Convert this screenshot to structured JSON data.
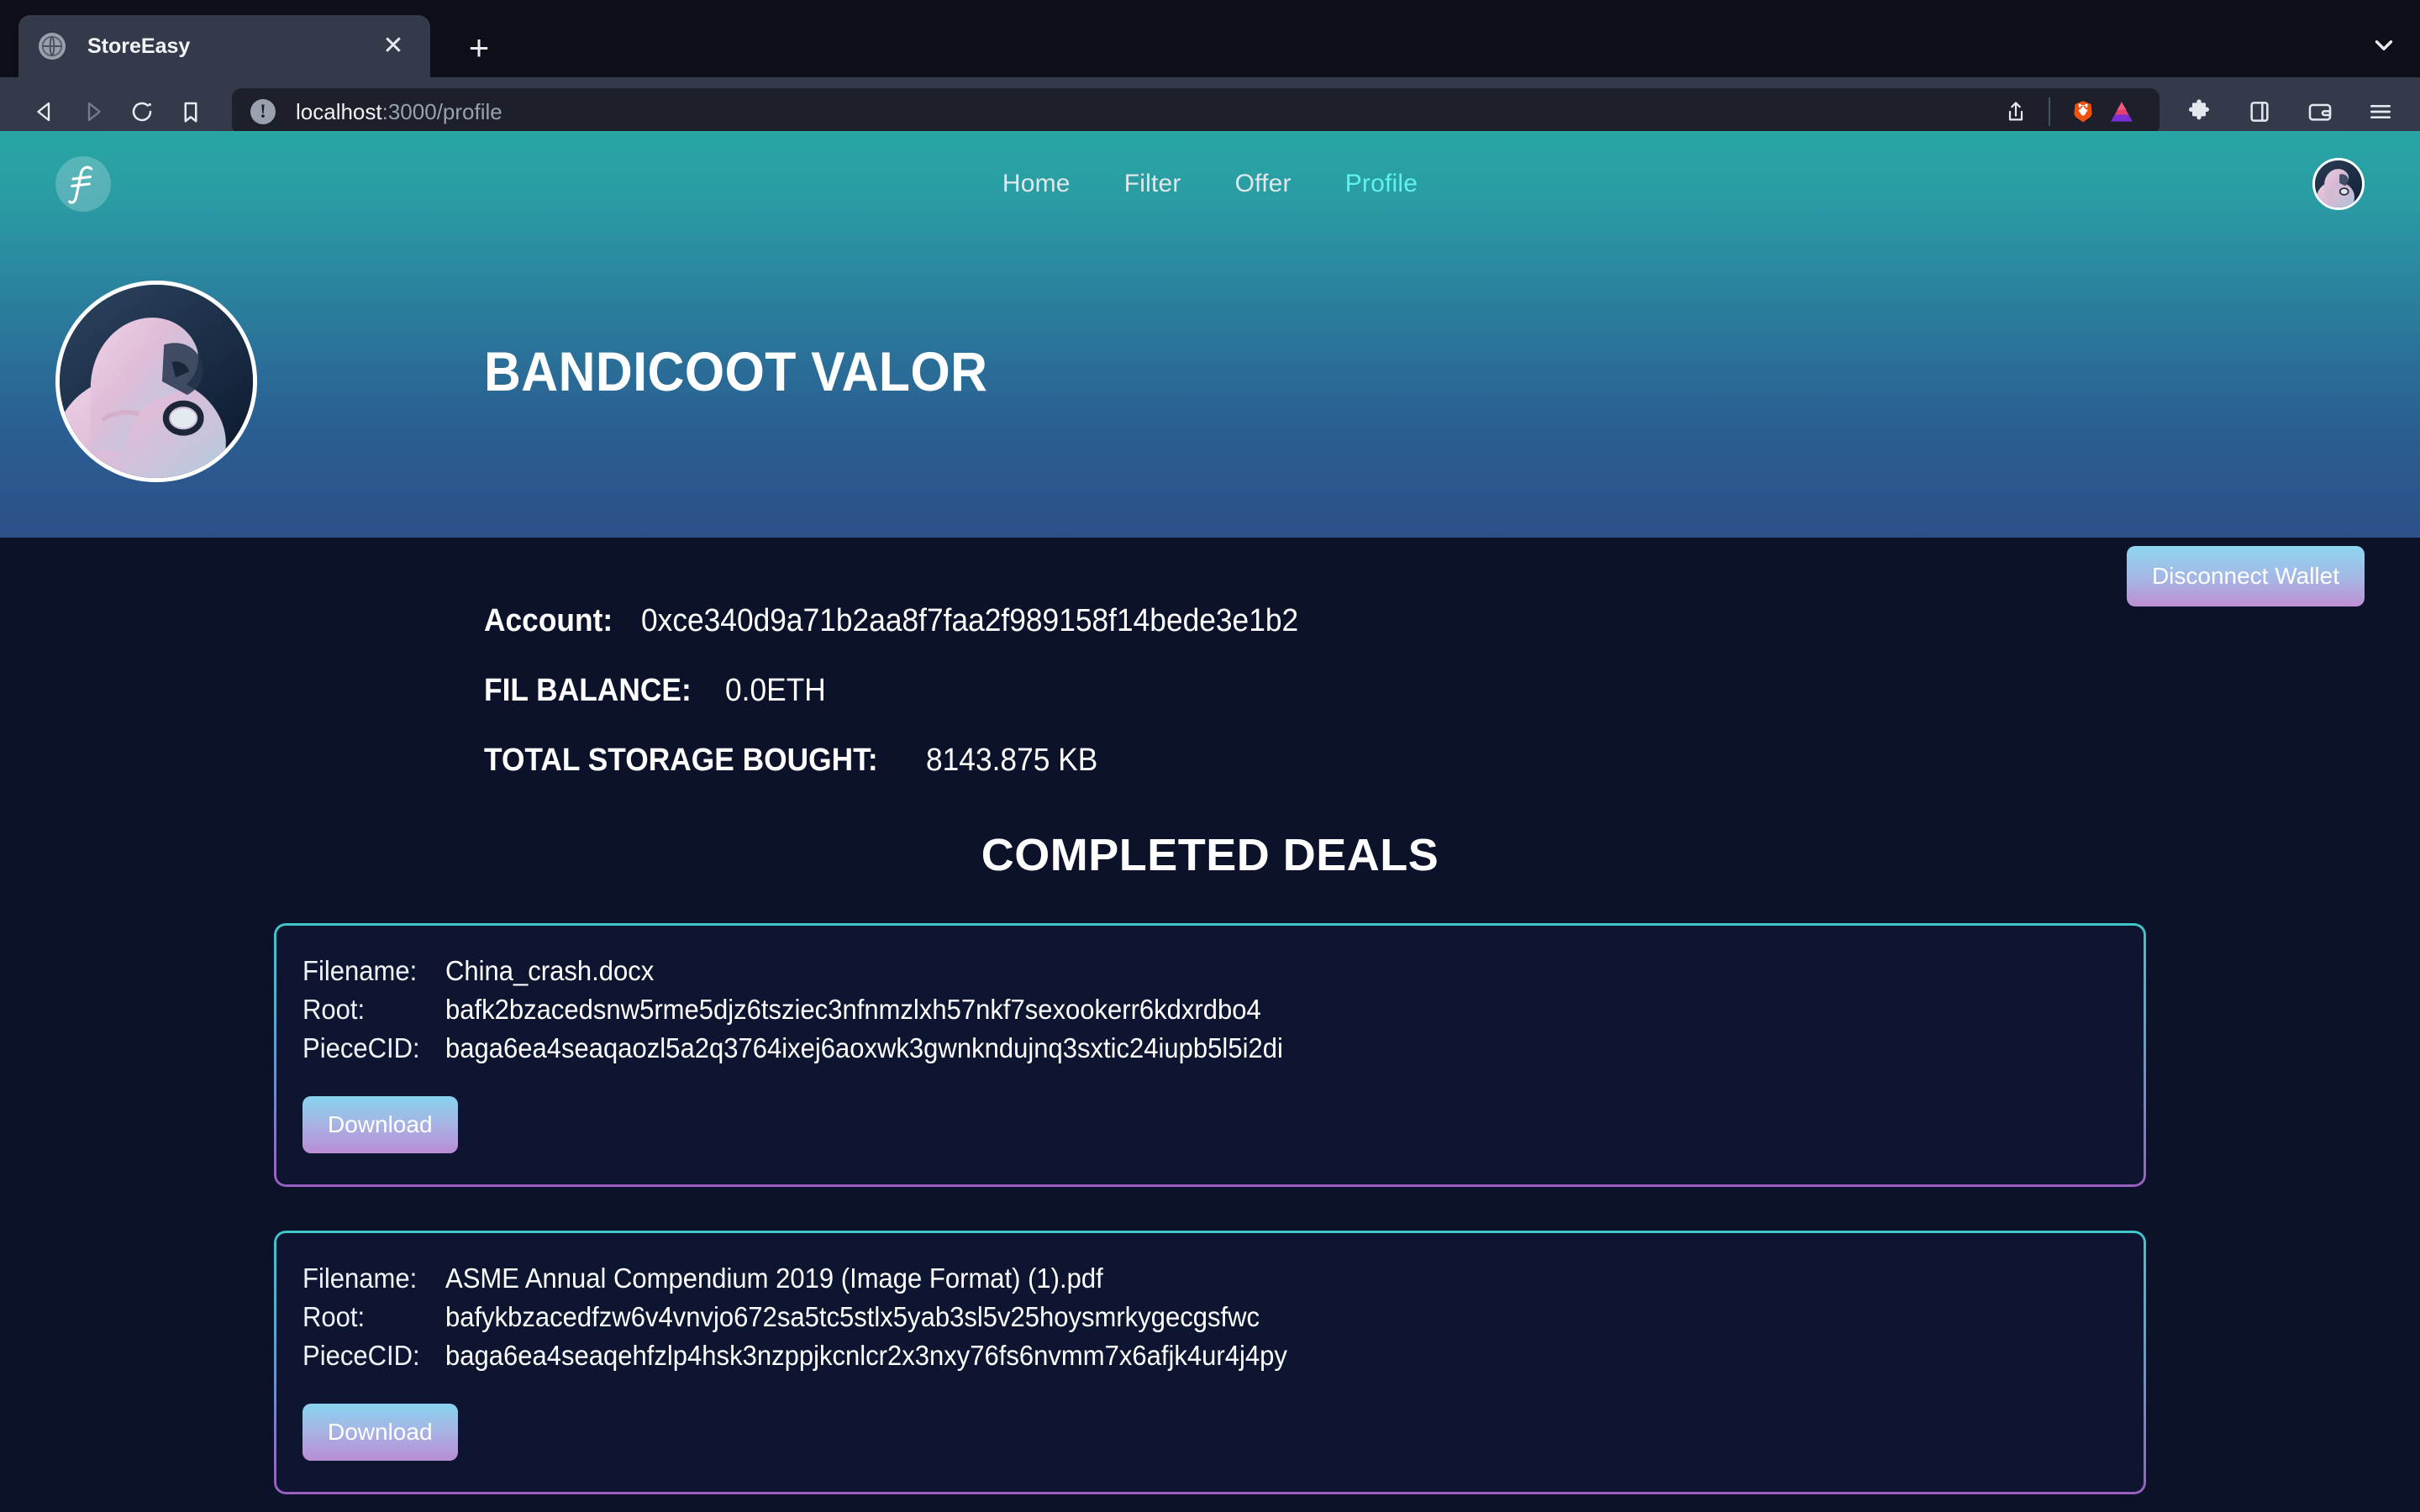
{
  "browser": {
    "tab": {
      "title": "StoreEasy",
      "favicon_icon": "globe-icon",
      "close_icon": "close-icon"
    },
    "new_tab_label": "+",
    "tab_list_chevron": "chevron-down-icon",
    "back_icon": "back-arrow-icon",
    "forward_icon": "forward-arrow-icon",
    "reload_icon": "reload-icon",
    "bookmark_icon": "bookmark-icon",
    "url": {
      "host": "localhost",
      "path": ":3000/profile",
      "full": "localhost:3000/profile",
      "info_icon": "info-icon"
    },
    "url_actions": {
      "share_icon": "share-icon",
      "brave_shields_icon": "brave-lion-icon",
      "bat_rewards_icon": "bat-triangle-icon"
    },
    "toolbar": {
      "extensions_icon": "puzzle-piece-icon",
      "sidebar_icon": "sidebar-panel-icon",
      "wallet_icon": "wallet-icon",
      "menu_icon": "hamburger-menu-icon"
    }
  },
  "site": {
    "logo_icon": "filecoin-logo-icon",
    "nav": [
      {
        "label": "Home",
        "active": false
      },
      {
        "label": "Filter",
        "active": false
      },
      {
        "label": "Offer",
        "active": false
      },
      {
        "label": "Profile",
        "active": true
      }
    ],
    "nav_avatar_name": "user-avatar",
    "profile": {
      "name": "BANDICOOT VALOR",
      "avatar_name": "profile-avatar",
      "disconnect_label": "Disconnect Wallet"
    },
    "stats": [
      {
        "label": "Account:",
        "value": "0xce340d9a71b2aa8f7faa2f989158f14bede3e1b2"
      },
      {
        "label": "FIL BALANCE:",
        "value": "0.0ETH"
      },
      {
        "label": "TOTAL STORAGE BOUGHT:",
        "value": "8143.875 KB"
      }
    ],
    "deals_heading": "COMPLETED DEALS",
    "field_labels": {
      "filename": "Filename:",
      "root": "Root:",
      "piececid": "PieceCID:"
    },
    "download_label": "Download",
    "deals": [
      {
        "filename": "China_crash.docx",
        "root": "bafk2bzacedsnw5rme5djz6tsziec3nfnmzlxh57nkf7sexookerr6kdxrdbo4",
        "piececid": "baga6ea4seaqaozl5a2q3764ixej6aoxwk3gwnkndujnq3sxtic24iupb5l5i2di"
      },
      {
        "filename": "ASME Annual Compendium 2019 (Image Format) (1).pdf",
        "root": "bafykbzacedfzw6v4vnvjo672sa5tc5stlx5yab3sl5v25hoysmrkygecgsfwc",
        "piececid": "baga6ea4seaqehfzlp4hsk3nzppjkcnlcr2x3nxy76fs6nvmm7x6afjk4ur4j4py"
      }
    ]
  },
  "colors": {
    "accent_cyan": "#5ff2ef",
    "hero_top": "#27a6a3",
    "hero_bottom": "#2c4f8a",
    "page_bg": "#0b1229",
    "card_border_top": "#3fc7cb",
    "card_border_bottom": "#9a5fbf",
    "button_gradient_top": "#87d3ef",
    "button_gradient_bottom": "#b98dd4"
  }
}
